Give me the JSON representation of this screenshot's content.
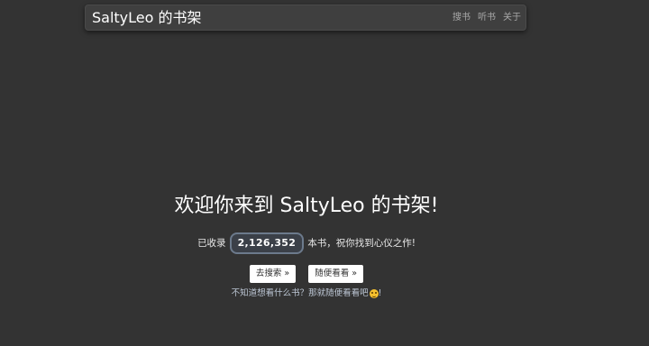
{
  "navbar": {
    "brand": "SaltyLeo 的书架",
    "links": [
      "搜书",
      "听书",
      "关于"
    ]
  },
  "hero": {
    "title": "欢迎你来到 SaltyLeo 的书架!",
    "count_prefix": "已收录",
    "count_value": "2,126,352",
    "count_suffix": "本书，祝你找到心仪之作!",
    "search_button": "去搜索 »",
    "random_button": "随便看看 »",
    "hint_text": "不知道想看什么书？那就随便看看吧",
    "hint_icon": "grinning-face-icon",
    "hint_end": "!"
  },
  "colors": {
    "background": "#333333",
    "navbar": "#3f3f3f",
    "badge_border": "#6c7a8c",
    "hint": "#bcc6d4"
  }
}
